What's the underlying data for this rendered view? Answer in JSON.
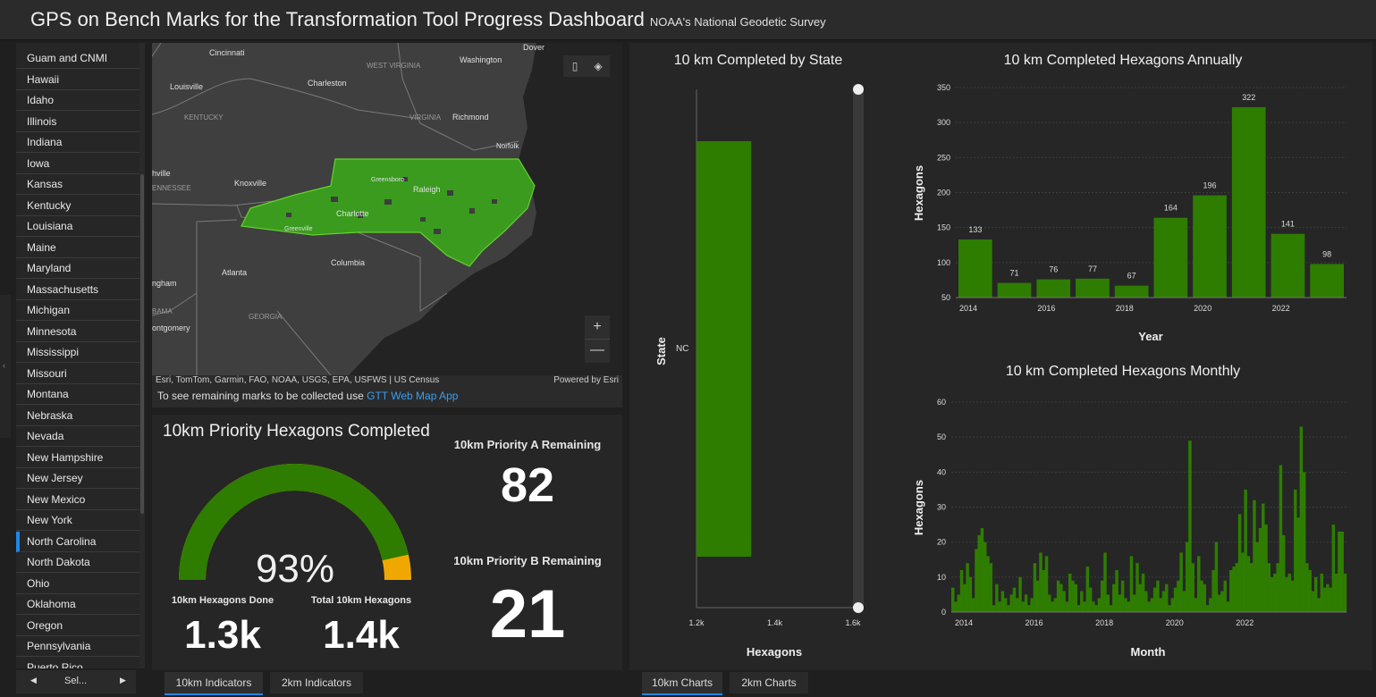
{
  "header": {
    "title": "GPS on Bench Marks for the Transformation Tool Progress Dashboard",
    "subtitle": "NOAA's National Geodetic Survey"
  },
  "sidebar": {
    "items": [
      "Guam and CNMI",
      "Hawaii",
      "Idaho",
      "Illinois",
      "Indiana",
      "Iowa",
      "Kansas",
      "Kentucky",
      "Louisiana",
      "Maine",
      "Maryland",
      "Massachusetts",
      "Michigan",
      "Minnesota",
      "Mississippi",
      "Missouri",
      "Montana",
      "Nebraska",
      "Nevada",
      "New Hampshire",
      "New Jersey",
      "New Mexico",
      "New York",
      "North Carolina",
      "North Dakota",
      "Ohio",
      "Oklahoma",
      "Oregon",
      "Pennsylvania",
      "Puerto Rico"
    ],
    "selected": "North Carolina",
    "nav_label": "Sel..."
  },
  "map": {
    "cities": [
      "Cincinnati",
      "Washington",
      "Dover",
      "Charleston",
      "Louisville",
      "WEST VIRGINIA",
      "KENTUCKY",
      "VIRGINIA",
      "Richmond",
      "Norfolk",
      "Greensboro",
      "Raleigh",
      "Knoxville",
      "Charlotte",
      "Greenville",
      "Columbia",
      "Atlanta",
      "GEORGIA",
      "hville",
      "ENNESSEE",
      "ngham",
      "BAMA",
      "ontgomery"
    ],
    "attribution": "Esri, TomTom, Garmin, FAO, NOAA, USGS, EPA, USFWS | US Census",
    "powered": "Powered by Esri",
    "remaining_text": "To see remaining marks to be collected use",
    "link_text": "GTT Web Map App",
    "fill_color": "#3a9b1f"
  },
  "gauge": {
    "title": "10km Priority Hexagons Completed",
    "percent_label": "93%",
    "percent": 0.93,
    "done_label": "10km Hexagons Done",
    "done_value": "1.3k",
    "total_label": "Total 10km Hexagons",
    "total_value": "1.4k",
    "done_color": "#2e7d00",
    "remaining_color": "#f0a800"
  },
  "indicators": {
    "a_label": "10km Priority A Remaining",
    "a_value": "82",
    "b_label": "10km Priority B Remaining",
    "b_value": "21"
  },
  "tabs": {
    "left": [
      "10km Indicators",
      "2km Indicators"
    ],
    "right": [
      "10km Charts",
      "2km Charts"
    ]
  },
  "chart_data": [
    {
      "type": "bar",
      "title": "10 km Completed by State",
      "orientation": "horizontal",
      "categories": [
        "NC"
      ],
      "values": [
        1340
      ],
      "xlabel": "Hexagons",
      "ylabel": "State",
      "xlim": [
        1200,
        1600
      ],
      "xticks": [
        "1.2k",
        "1.4k",
        "1.6k"
      ],
      "color": "#2e7d00"
    },
    {
      "type": "bar",
      "title": "10 km Completed Hexagons Annually",
      "categories": [
        2014,
        2015,
        2016,
        2017,
        2018,
        2019,
        2020,
        2021,
        2022,
        2023
      ],
      "values": [
        133,
        71,
        76,
        77,
        67,
        164,
        196,
        322,
        141,
        98
      ],
      "xlabel": "Year",
      "ylabel": "Hexagons",
      "ylim": [
        50,
        350
      ],
      "yticks": [
        50,
        100,
        150,
        200,
        250,
        300,
        350
      ],
      "xticks": [
        "2014",
        "2016",
        "2018",
        "2020",
        "2022"
      ],
      "color": "#2e7d00",
      "grid": true
    },
    {
      "type": "bar",
      "title": "10 km Completed Hexagons Monthly",
      "x_start": "2014-01",
      "values": [
        7,
        3,
        5,
        12,
        8,
        14,
        10,
        4,
        18,
        22,
        24,
        20,
        16,
        14,
        2,
        8,
        3,
        6,
        4,
        2,
        5,
        7,
        4,
        10,
        3,
        5,
        2,
        4,
        14,
        9,
        17,
        12,
        16,
        5,
        3,
        4,
        9,
        8,
        6,
        3,
        11,
        9,
        8,
        2,
        6,
        3,
        13,
        7,
        3,
        2,
        4,
        9,
        17,
        5,
        2,
        8,
        12,
        5,
        9,
        4,
        3,
        16,
        5,
        14,
        8,
        11,
        6,
        3,
        4,
        7,
        9,
        4,
        6,
        8,
        2,
        4,
        7,
        9,
        17,
        6,
        20,
        49,
        14,
        4,
        16,
        9,
        8,
        2,
        4,
        12,
        20,
        5,
        6,
        9,
        3,
        12,
        13,
        14,
        28,
        17,
        35,
        16,
        14,
        32,
        20,
        24,
        31,
        25,
        14,
        10,
        11,
        14,
        42,
        22,
        10,
        11,
        9,
        35,
        27,
        53,
        40,
        14,
        12,
        6,
        10,
        4,
        11,
        7,
        8,
        7,
        25,
        11,
        23,
        23,
        11
      ],
      "xlabel": "Month",
      "ylabel": "Hexagons",
      "ylim": [
        0,
        60
      ],
      "yticks": [
        0,
        10,
        20,
        30,
        40,
        50,
        60
      ],
      "xticks": [
        "2014",
        "2016",
        "2018",
        "2020",
        "2022"
      ],
      "color": "#2e7d00",
      "grid": true
    }
  ]
}
